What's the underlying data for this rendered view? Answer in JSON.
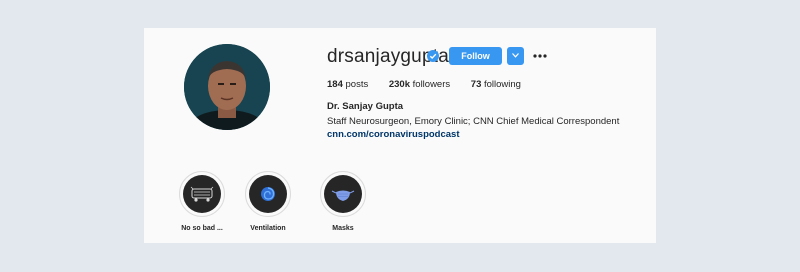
{
  "profile": {
    "username": "drsanjaygupta",
    "verified": true,
    "follow_label": "Follow",
    "posts_count": "184",
    "posts_label": "posts",
    "followers_count": "230k",
    "followers_label": "followers",
    "following_count": "73",
    "following_label": "following",
    "full_name": "Dr. Sanjay Gupta",
    "bio": "Staff Neurosurgeon, Emory Clinic; CNN Chief Medical Correspondent",
    "link": "cnn.com/coronaviruspodcast"
  },
  "highlights": [
    {
      "label": "No so bad ...",
      "icon": "pill-bus-icon"
    },
    {
      "label": "Ventilation",
      "icon": "swirl-icon"
    },
    {
      "label": "Masks",
      "icon": "mask-icon"
    }
  ],
  "colors": {
    "accent": "#3897f0",
    "link": "#003569",
    "page_bg": "#e3e7ee",
    "card_bg": "#fafafa"
  }
}
